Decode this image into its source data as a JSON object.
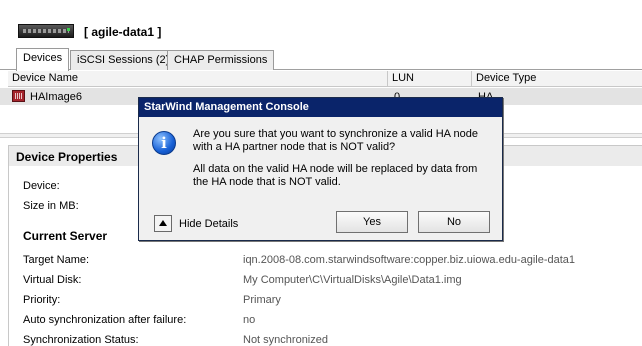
{
  "header": {
    "server_title": "[ agile-data1 ]"
  },
  "tabs": [
    {
      "label": "Devices"
    },
    {
      "label": "iSCSI Sessions (2)"
    },
    {
      "label": "CHAP Permissions"
    }
  ],
  "device_list": {
    "columns": [
      "Device Name",
      "LUN",
      "Device Type"
    ],
    "rows": [
      {
        "name": "HAImage6",
        "lun": "0",
        "type": "HA"
      }
    ]
  },
  "properties": {
    "title": "Device Properties",
    "device_label": "Device:",
    "size_label": "Size in MB:",
    "current_server_title": "Current Server",
    "fields": [
      {
        "label": "Target Name:",
        "value": "iqn.2008-08.com.starwindsoftware:copper.biz.uiowa.edu-agile-data1"
      },
      {
        "label": "Virtual Disk:",
        "value": "My Computer\\C\\VirtualDisks\\Agile\\Data1.img"
      },
      {
        "label": "Priority:",
        "value": "Primary"
      },
      {
        "label": "Auto synchronization after failure:",
        "value": "no"
      },
      {
        "label": "Synchronization Status:",
        "value": "Not synchronized"
      }
    ]
  },
  "dialog": {
    "title": "StarWind Management Console",
    "message_line1": "Are you sure that you want to synchronize a valid HA node",
    "message_line2": "with a HA partner node that is NOT valid?",
    "message_line3": "All data on the valid HA node will be replaced by data from",
    "message_line4": "the HA node that is NOT valid.",
    "hide_details": "Hide Details",
    "yes_label": "Yes",
    "no_label": "No",
    "icon_glyph": "i"
  },
  "colors": {
    "dialog_title_bg": "#0a246a",
    "selected_row_bg": "#e3e3e3",
    "device_icon": "#a5242c"
  }
}
